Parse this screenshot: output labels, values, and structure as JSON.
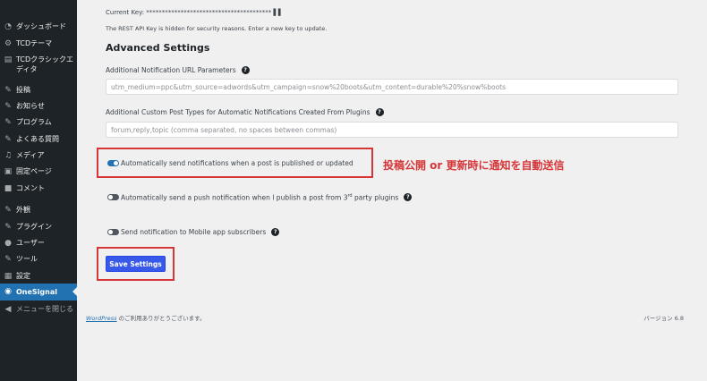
{
  "sidebar": {
    "items": [
      {
        "label": "ダッシュボード",
        "icon": "dashboard-icon",
        "glyph": "◔"
      },
      {
        "label": "TCDテーマ",
        "icon": "gear-icon",
        "glyph": "⚙"
      },
      {
        "label": "TCDクラシックエディタ",
        "icon": "editor-icon",
        "glyph": "▤"
      },
      {
        "label": "投稿",
        "icon": "pin-icon",
        "glyph": "✎"
      },
      {
        "label": "お知らせ",
        "icon": "pin-icon",
        "glyph": "✎"
      },
      {
        "label": "プログラム",
        "icon": "pin-icon",
        "glyph": "✎"
      },
      {
        "label": "よくある質問",
        "icon": "pin-icon",
        "glyph": "✎"
      },
      {
        "label": "メディア",
        "icon": "media-icon",
        "glyph": "♫"
      },
      {
        "label": "固定ページ",
        "icon": "page-icon",
        "glyph": "▣"
      },
      {
        "label": "コメント",
        "icon": "comment-icon",
        "glyph": "■"
      },
      {
        "label": "外観",
        "icon": "appearance-icon",
        "glyph": "✎"
      },
      {
        "label": "プラグイン",
        "icon": "plugin-icon",
        "glyph": "✎"
      },
      {
        "label": "ユーザー",
        "icon": "user-icon",
        "glyph": "●"
      },
      {
        "label": "ツール",
        "icon": "wrench-icon",
        "glyph": "✎"
      },
      {
        "label": "設定",
        "icon": "settings-icon",
        "glyph": "▦"
      },
      {
        "label": "OneSignal",
        "icon": "onesignal-icon",
        "glyph": "◉"
      },
      {
        "label": "メニューを閉じる",
        "icon": "collapse-icon",
        "glyph": "◀"
      }
    ]
  },
  "main": {
    "current_key_label": "Current Key:",
    "current_key_mask": "**************************************** ▌▌",
    "key_hint": "The REST API Key is hidden for security reasons. Enter a new key to update.",
    "section_title": "Advanced Settings",
    "url_params_label": "Additional Notification URL Parameters",
    "url_params_placeholder": "utm_medium=ppc&utm_source=adwords&utm_campaign=snow%20boots&utm_content=durable%20%snow%boots",
    "post_types_label": "Additional Custom Post Types for Automatic Notifications Created From Plugins",
    "post_types_placeholder": "forum,reply,topic  (comma separated, no spaces between commas)",
    "toggle_auto_send": "Automatically send notifications when a post is published or updated",
    "toggle_auto_send_on": true,
    "toggle_push_pre": "Automatically send a push notification when I publish a post from 3",
    "toggle_push_sup": "rd",
    "toggle_push_post": " party plugins",
    "toggle_push_on": false,
    "toggle_mobile": "Send notification to Mobile app subscribers",
    "toggle_mobile_on": false,
    "save_label": "Save Settings",
    "annotation": "投稿公開 or 更新時に通知を自動送信"
  },
  "footer": {
    "link_text": "WordPress",
    "thanks": " のご利用ありがとうございます。",
    "version": "バージョン 6.8"
  },
  "colors": {
    "sidebar_bg": "#1d2327",
    "active_blue": "#2271b1",
    "button_blue": "#3858e9",
    "annotation_red": "#d63638"
  }
}
